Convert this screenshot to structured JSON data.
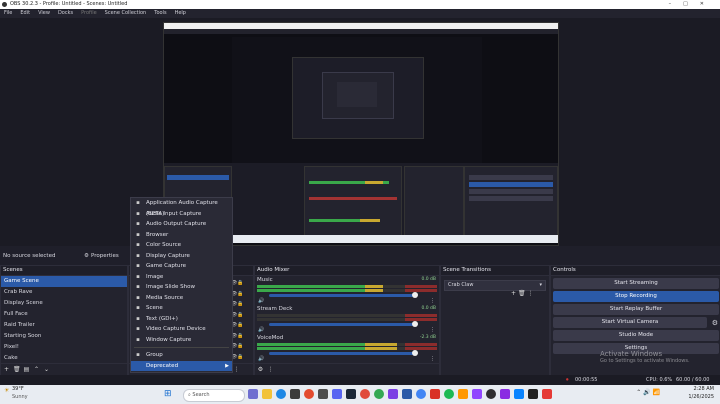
{
  "window": {
    "title": "OBS 30.2.3 - Profile: Untitled - Scenes: Untitled"
  },
  "menubar": {
    "items": [
      "File",
      "Edit",
      "View",
      "Docks",
      "Profile",
      "Scene Collection",
      "Tools",
      "Help"
    ]
  },
  "source_bar": {
    "no_source": "No source selected",
    "properties": "Properties"
  },
  "scenes": {
    "header": "Scenes",
    "items": [
      "Game Scene",
      "Crab Rave",
      "Display Scene",
      "Full Face",
      "Raid Trailer",
      "Starting Soon",
      "Pixel!",
      "Cake"
    ],
    "selected_index": 0
  },
  "context_menu": {
    "items": [
      {
        "label": "Application Audio Capture (BETA)",
        "icon": "app-audio-icon"
      },
      {
        "label": "Audio Input Capture",
        "icon": "microphone-icon"
      },
      {
        "label": "Audio Output Capture",
        "icon": "speaker-icon"
      },
      {
        "label": "Browser",
        "icon": "globe-icon"
      },
      {
        "label": "Color Source",
        "icon": "palette-icon"
      },
      {
        "label": "Display Capture",
        "icon": "monitor-icon"
      },
      {
        "label": "Game Capture",
        "icon": "gamepad-icon"
      },
      {
        "label": "Image",
        "icon": "image-icon"
      },
      {
        "label": "Image Slide Show",
        "icon": "slideshow-icon"
      },
      {
        "label": "Media Source",
        "icon": "play-icon"
      },
      {
        "label": "Scene",
        "icon": "scene-icon"
      },
      {
        "label": "Text (GDI+)",
        "icon": "text-icon"
      },
      {
        "label": "Video Capture Device",
        "icon": "camera-icon"
      },
      {
        "label": "Window Capture",
        "icon": "window-icon"
      },
      {
        "label": "Group",
        "icon": "folder-icon"
      },
      {
        "label": "Deprecated",
        "icon": "",
        "submenu": true
      }
    ]
  },
  "mixer": {
    "header": "Audio Mixer",
    "channels": [
      {
        "name": "Music",
        "db": "0.0 dB",
        "level": 0.7
      },
      {
        "name": "Stream Deck",
        "db": "0.0 dB",
        "level": 0.0
      },
      {
        "name": "VoiceMod",
        "db": "-2.3 dB",
        "level": 0.78
      }
    ]
  },
  "transitions": {
    "header": "Scene Transitions",
    "selected": "Crab Claw"
  },
  "controls": {
    "header": "Controls",
    "buttons": [
      {
        "label": "Start Streaming",
        "active": false
      },
      {
        "label": "Stop Recording",
        "active": true
      },
      {
        "label": "Start Replay Buffer",
        "active": false
      },
      {
        "label": "Start Virtual Camera",
        "active": false
      },
      {
        "label": "Studio Mode",
        "active": false
      },
      {
        "label": "Settings",
        "active": false
      }
    ]
  },
  "statusbar": {
    "rec_time": "00:00:55",
    "cpu": "CPU: 0.6%",
    "fps": "60.00 / 60.00 FPS"
  },
  "watermark": {
    "line1": "Activate Windows",
    "line2": "Go to Settings to activate Windows."
  },
  "taskbar": {
    "weather_temp": "39°F",
    "weather_desc": "Sunny",
    "search_placeholder": "Search",
    "time": "2:28 AM",
    "date": "1/26/2025"
  }
}
